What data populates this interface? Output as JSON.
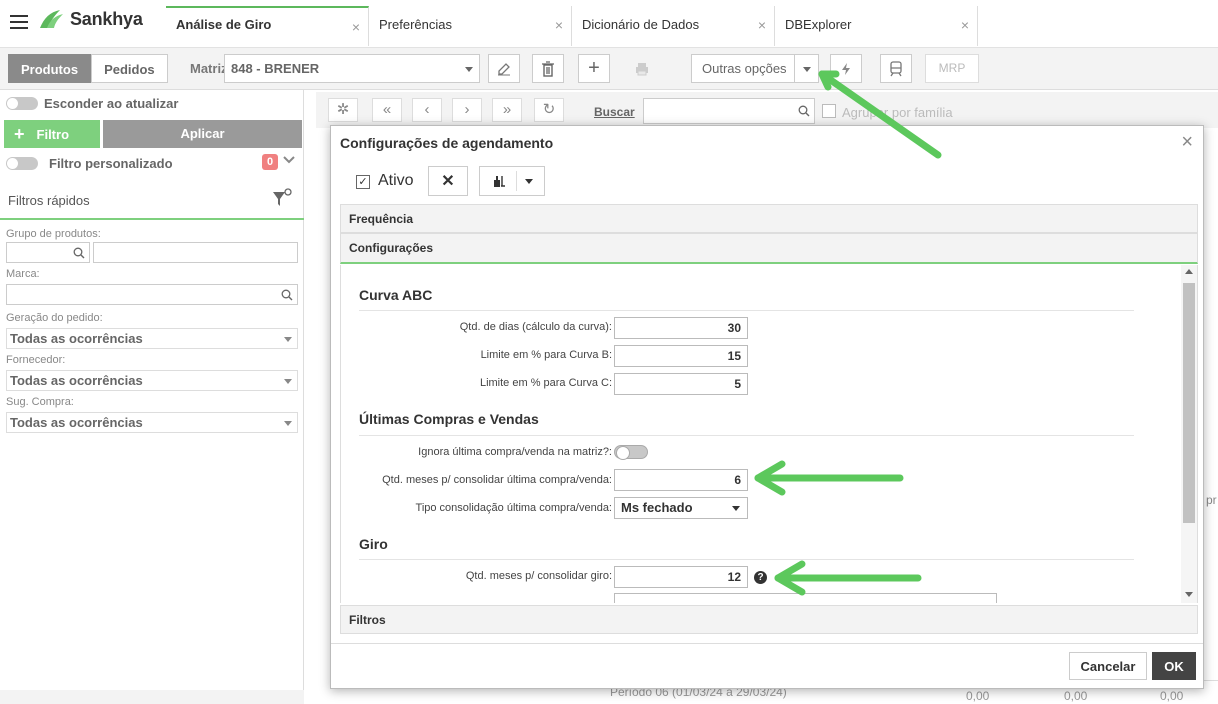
{
  "app": {
    "logo": "Sankhya"
  },
  "tabs": [
    {
      "label": "Análise de Giro",
      "active": true
    },
    {
      "label": "Preferências"
    },
    {
      "label": "Dicionário de Dados"
    },
    {
      "label": "DBExplorer"
    }
  ],
  "toolbar": {
    "products": "Produtos",
    "orders": "Pedidos",
    "matriz_label": "Matriz",
    "matriz_value": "848 - BRENER",
    "more_options": "Outras opções",
    "mrp": "MRP"
  },
  "left": {
    "hide_on_update": "Esconder ao atualizar",
    "filter": "Filtro",
    "apply": "Aplicar",
    "custom_filter": "Filtro personalizado",
    "custom_filter_count": "0",
    "quick_filters": "Filtros rápidos",
    "product_group_label": "Grupo de produtos:",
    "brand_label": "Marca:",
    "order_gen_label": "Geração do pedido:",
    "order_gen_value": "Todas as ocorrências",
    "supplier_label": "Fornecedor:",
    "supplier_value": "Todas as ocorrências",
    "sug_label": "Sug. Compra:",
    "sug_value": "Todas as ocorrências"
  },
  "grid": {
    "search_link": "Buscar",
    "group_by": "Agrupar por família",
    "footer_row": "Período 06 (01/03/24 a 29/03/24)",
    "footer_v1": "0,00",
    "footer_v2": "0,00",
    "footer_v3": "0,00",
    "cut_text": "pr"
  },
  "modal": {
    "title": "Configurações de agendamento",
    "active_label": "Ativo",
    "sections": {
      "frequency": "Frequência",
      "settings": "Configurações",
      "filters": "Filtros"
    },
    "abc": {
      "title": "Curva ABC",
      "days_label": "Qtd. de dias (cálculo da curva):",
      "days_value": "30",
      "limit_b_label": "Limite em % para Curva B:",
      "limit_b_value": "15",
      "limit_c_label": "Limite em % para Curva C:",
      "limit_c_value": "5"
    },
    "last": {
      "title": "Últimas Compras e Vendas",
      "ignore_label": "Ignora última compra/venda na matriz?:",
      "months_label": "Qtd. meses p/ consolidar última compra/venda:",
      "months_value": "6",
      "type_label": "Tipo consolidação última compra/venda:",
      "type_value": "Ms fechado"
    },
    "giro": {
      "title": "Giro",
      "months_label": "Qtd. meses p/ consolidar giro:",
      "months_value": "12"
    },
    "cancel": "Cancelar",
    "ok": "OK"
  },
  "colors": {
    "accent": "#5cb85c",
    "arrow": "#5cc85c",
    "dark_button": "#444444"
  }
}
